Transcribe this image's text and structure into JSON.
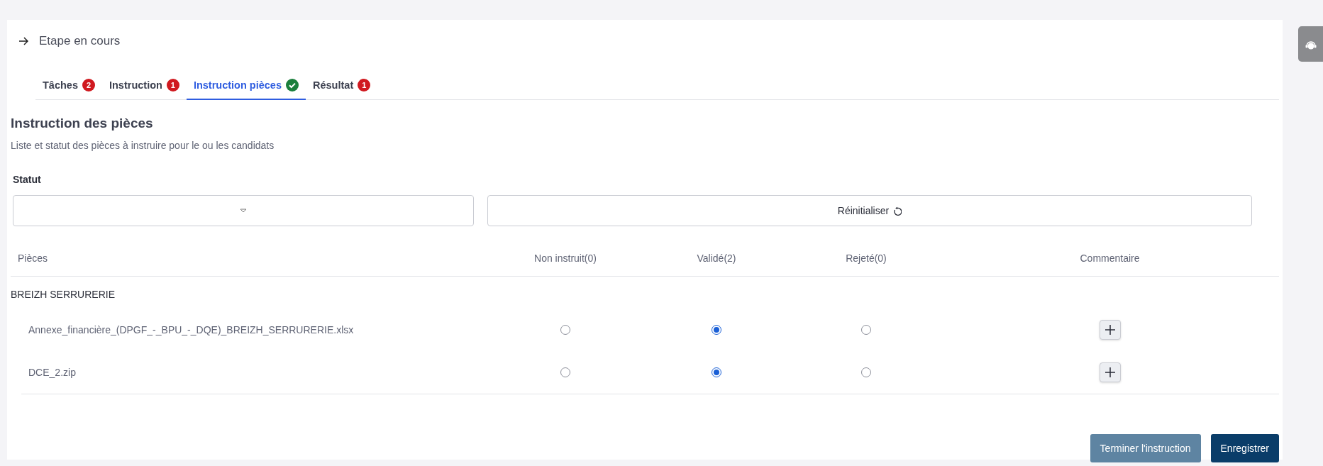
{
  "header": {
    "title": "Etape en cours"
  },
  "tabs": [
    {
      "label": "Tâches",
      "badge": "2",
      "kind": "count",
      "selected": false
    },
    {
      "label": "Instruction",
      "badge": "1",
      "kind": "count",
      "selected": false
    },
    {
      "label": "Instruction pièces",
      "kind": "check",
      "selected": true
    },
    {
      "label": "Résultat",
      "badge": "1",
      "kind": "count",
      "selected": false
    }
  ],
  "section": {
    "title": "Instruction des pièces",
    "subtitle": "Liste et statut des pièces à instruire pour le ou les candidats"
  },
  "filter": {
    "label": "Statut",
    "reset_button": "Réinitialiser"
  },
  "table": {
    "columns": [
      "Pièces",
      "Non instruit(0)",
      "Validé(2)",
      "Rejeté(0)",
      "Commentaire"
    ],
    "groups": [
      {
        "name": "BREIZH SERRURERIE",
        "rows": [
          {
            "name": "Annexe_financière_(DPGF_-_BPU_-_DQE)_BREIZH_SERRURERIE.xlsx",
            "choices": [
              {
                "selected": false
              },
              {
                "selected": true
              },
              {
                "selected": false
              }
            ]
          },
          {
            "name": "DCE_2.zip",
            "choices": [
              {
                "selected": false
              },
              {
                "selected": true
              },
              {
                "selected": false
              }
            ]
          }
        ]
      }
    ]
  },
  "buttons": [
    {
      "label": "Terminer l'instruction",
      "kind": "secondary"
    },
    {
      "label": "Enregistrer",
      "kind": "primary"
    }
  ]
}
